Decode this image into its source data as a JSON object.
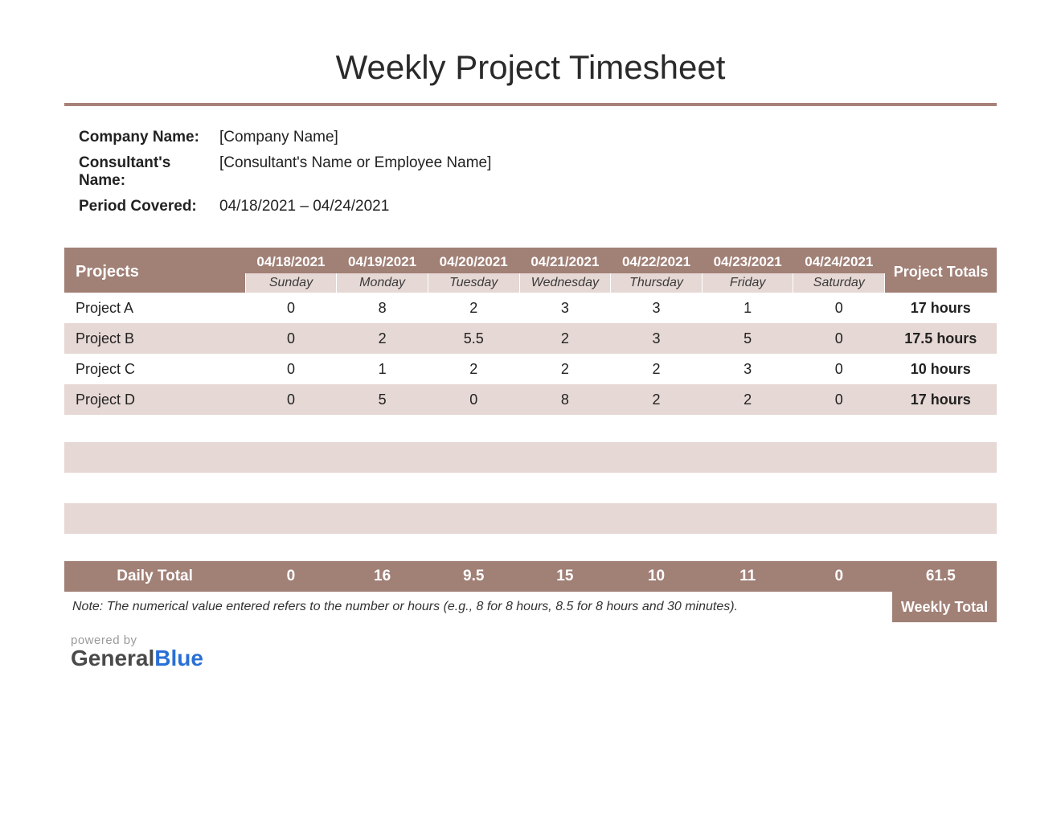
{
  "title": "Weekly Project Timesheet",
  "meta": {
    "company_label": "Company Name:",
    "company_value": "[Company Name]",
    "consultant_label": "Consultant's Name:",
    "consultant_value": "[Consultant's Name or Employee Name]",
    "period_label": "Period Covered:",
    "period_value": "04/18/2021 – 04/24/2021"
  },
  "headers": {
    "projects": "Projects",
    "project_totals": "Project Totals",
    "dates": [
      "04/18/2021",
      "04/19/2021",
      "04/20/2021",
      "04/21/2021",
      "04/22/2021",
      "04/23/2021",
      "04/24/2021"
    ],
    "days": [
      "Sunday",
      "Monday",
      "Tuesday",
      "Wednesday",
      "Thursday",
      "Friday",
      "Saturday"
    ]
  },
  "rows": [
    {
      "name": "Project A",
      "hours": [
        "0",
        "8",
        "2",
        "3",
        "3",
        "1",
        "0"
      ],
      "total": "17 hours"
    },
    {
      "name": "Project B",
      "hours": [
        "0",
        "2",
        "5.5",
        "2",
        "3",
        "5",
        "0"
      ],
      "total": "17.5 hours"
    },
    {
      "name": "Project C",
      "hours": [
        "0",
        "1",
        "2",
        "2",
        "2",
        "3",
        "0"
      ],
      "total": "10 hours"
    },
    {
      "name": "Project D",
      "hours": [
        "0",
        "5",
        "0",
        "8",
        "2",
        "2",
        "0"
      ],
      "total": "17 hours"
    }
  ],
  "daily_total": {
    "label": "Daily Total",
    "values": [
      "0",
      "16",
      "9.5",
      "15",
      "10",
      "11",
      "0"
    ],
    "grand": "61.5"
  },
  "weekly_total_label": "Weekly Total",
  "note": "Note: The numerical value entered refers to the number or hours (e.g., 8 for 8 hours, 8.5 for 8 hours and 30 minutes).",
  "powered": {
    "by": "powered by",
    "general": "General",
    "blue": "Blue"
  },
  "chart_data": {
    "type": "table",
    "title": "Weekly Project Timesheet",
    "columns": [
      "Project",
      "04/18/2021 Sunday",
      "04/19/2021 Monday",
      "04/20/2021 Tuesday",
      "04/21/2021 Wednesday",
      "04/22/2021 Thursday",
      "04/23/2021 Friday",
      "04/24/2021 Saturday",
      "Project Totals"
    ],
    "rows": [
      [
        "Project A",
        0,
        8,
        2,
        3,
        3,
        1,
        0,
        17
      ],
      [
        "Project B",
        0,
        2,
        5.5,
        2,
        3,
        5,
        0,
        17.5
      ],
      [
        "Project C",
        0,
        1,
        2,
        2,
        2,
        3,
        0,
        10
      ],
      [
        "Project D",
        0,
        5,
        0,
        8,
        2,
        2,
        0,
        17
      ]
    ],
    "daily_totals": [
      0,
      16,
      9.5,
      15,
      10,
      11,
      0
    ],
    "weekly_total": 61.5
  }
}
